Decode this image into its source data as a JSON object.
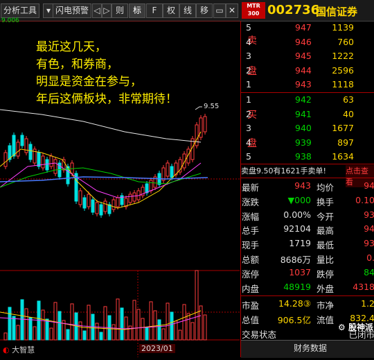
{
  "toolbar": {
    "tabs": [
      "分析工具",
      "闪电预警",
      "则",
      "标",
      "F",
      "权",
      "线",
      "移"
    ],
    "buttons": [
      "◁",
      "▷"
    ]
  },
  "stock": {
    "code": "002736",
    "name": "国信证券",
    "mtr_badge": "MTR 300"
  },
  "chart": {
    "top_label": "9.006",
    "price_high_label": "9.55",
    "bottom_label": "大智慧",
    "date_label": "2023/01"
  },
  "overlay": {
    "lines": [
      "最近这几天，",
      "有色，和券商，",
      "明显是资金在参与，",
      "年后这俩板块，非常期待！"
    ]
  },
  "sell_side": {
    "label_top": "卖",
    "label_bottom": "盘",
    "rows": [
      {
        "level": "5",
        "price": "947",
        "vol": "1139"
      },
      {
        "level": "4",
        "price": "946",
        "vol": "760"
      },
      {
        "level": "3",
        "price": "945",
        "vol": "1222"
      },
      {
        "level": "2",
        "price": "944",
        "vol": "2596"
      },
      {
        "level": "1",
        "price": "943",
        "vol": "1118"
      }
    ]
  },
  "buy_side": {
    "label_top": "买",
    "label_bottom": "盘",
    "rows": [
      {
        "level": "1",
        "price": "942",
        "vol": "63"
      },
      {
        "level": "2",
        "price": "941",
        "vol": "40"
      },
      {
        "level": "3",
        "price": "940",
        "vol": "1677"
      },
      {
        "level": "4",
        "price": "939",
        "vol": "897"
      },
      {
        "level": "5",
        "price": "938",
        "vol": "1634"
      }
    ]
  },
  "alert": {
    "text": "卖盘9.50有1621手卖单!",
    "button": "点击查看"
  },
  "quote": {
    "left": [
      {
        "label": "最新",
        "value": "943"
      },
      {
        "label": "涨跌",
        "value": "▼000"
      },
      {
        "label": "涨幅",
        "value": "0.00%"
      },
      {
        "label": "总手",
        "value": "92104"
      },
      {
        "label": "现手",
        "value": "1719"
      },
      {
        "label": "总额",
        "value": "8686万"
      },
      {
        "label": "涨停",
        "value": "1037"
      },
      {
        "label": "内盘",
        "value": "48919"
      }
    ],
    "right": [
      {
        "label": "均价",
        "value": "94"
      },
      {
        "label": "换手",
        "value": "0.10"
      },
      {
        "label": "今开",
        "value": "93"
      },
      {
        "label": "最高",
        "value": "94"
      },
      {
        "label": "最低",
        "value": "93"
      },
      {
        "label": "量比",
        "value": "0."
      },
      {
        "label": "跌停",
        "value": "84"
      },
      {
        "label": "外盘",
        "value": "4318"
      }
    ]
  },
  "fundamentals": [
    {
      "label": "市盈",
      "value": "14.28③",
      "label2": "市净",
      "value2": "1.2"
    },
    {
      "label": "总值",
      "value": "906.5亿",
      "label2": "流值",
      "value2": "832.4"
    },
    {
      "label": "交易状态",
      "value": "",
      "label2": "",
      "value2": "已闭市"
    }
  ],
  "footer": {
    "tab": "财务数据",
    "watermark": "股神派"
  },
  "colors": {
    "up": "#ff3c3c",
    "down": "#00d200",
    "accent": "#ffd700",
    "overlay_text": "#ffee00"
  }
}
